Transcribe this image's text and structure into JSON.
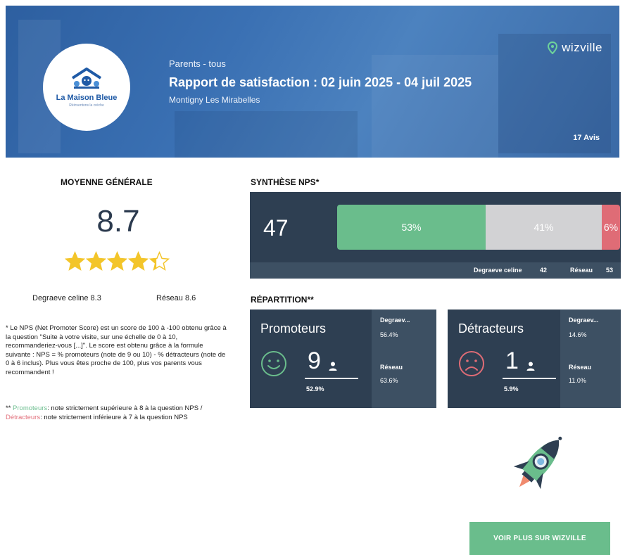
{
  "header": {
    "segment": "Parents - tous",
    "title": "Rapport de satisfaction : 02 juin 2025 - 04 juil 2025",
    "location": "Montigny Les Mirabelles",
    "brand": "wizville",
    "reviews_count": "17 Avis",
    "logo": {
      "name": "La Maison Bleue",
      "tagline": "Réinventons la crèche"
    }
  },
  "moyenne": {
    "title": "MOYENNE GÉNÉRALE",
    "score": "8.7",
    "stars_rating": 4.35,
    "stars_max": 5,
    "compare_site": "Degraeve celine  8.3",
    "compare_network": "Réseau  8.6"
  },
  "notes": {
    "nps_explanation": "* Le NPS (Net Promoter Score) est un score de 100 à -100 obtenu grâce à la question \"Suite à votre visite, sur une échelle de 0 à 10, recommanderiez-vous [...]\". Le score est obtenu grâce à la formule suivante : NPS = % promoteurs (note de 9 ou 10) - % détracteurs (note de 0 à 6 inclus). Plus vous êtes proche de 100, plus vos parents vous recommandent !",
    "legend_prefix": "** ",
    "legend_promoteurs": "Promoteurs",
    "legend_promoteurs_text": ": note strictement supérieure à 8 à la question NPS / ",
    "legend_detracteurs": "Détracteurs",
    "legend_detracteurs_text": ": note strictement inférieure à 7 à la question NPS"
  },
  "nps": {
    "title": "SYNTHÈSE NPS*",
    "score": "47",
    "promoters_pct": "53%",
    "passives_pct": "41%",
    "detractors_pct": "6%",
    "promoters_share": 0.53,
    "passives_share": 0.41,
    "detractors_share": 0.06,
    "footer_site_label": "Degraeve celine",
    "footer_site_value": "42",
    "footer_network_label": "Réseau",
    "footer_network_value": "53",
    "colors": {
      "promoters": "#6abd8c",
      "passives": "#d2d2d4",
      "detractors": "#df6c76",
      "panel": "#2e3f52"
    }
  },
  "repartition": {
    "title": "RÉPARTITION**",
    "promoteurs": {
      "name": "Promoteurs",
      "count": "9",
      "pct": "52.9%",
      "site_label": "Degraev...",
      "site_value": "56.4%",
      "network_label": "Réseau",
      "network_value": "63.6%",
      "icon": "smile-face-icon"
    },
    "detracteurs": {
      "name": "Détracteurs",
      "count": "1",
      "pct": "5.9%",
      "site_label": "Degraev...",
      "site_value": "14.6%",
      "network_label": "Réseau",
      "network_value": "11.0%",
      "icon": "sad-face-icon"
    }
  },
  "cta": {
    "label": "VOIR PLUS SUR WIZVILLE"
  }
}
